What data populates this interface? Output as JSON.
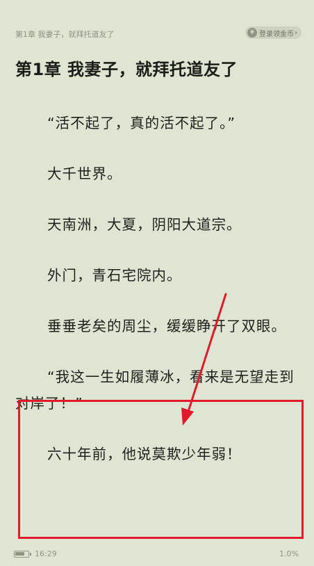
{
  "header": {
    "chapter_short": "第1章 我妻子，就拜托道友了",
    "coin_button": {
      "icon": "yen-coin-icon",
      "label": "登录领金币",
      "chevron": "›"
    }
  },
  "chapter": {
    "title": "第1章 我妻子，就拜托道友了",
    "paragraphs": [
      "“活不起了，真的活不起了。”",
      "大千世界。",
      "天南洲，大夏，阴阳大道宗。",
      "外门，青石宅院内。",
      "垂垂老矣的周尘，缓缓睁开了双眼。",
      "“我这一生如履薄冰，看来是无望走到对岸了！”",
      "六十年前，他说莫欺少年弱！"
    ]
  },
  "footer": {
    "battery_icon": "battery-icon",
    "battery_level": 0.75,
    "time": "16:29",
    "progress": "1.0%"
  },
  "annotation": {
    "color": "#e0192b",
    "type": "red-arrow-and-box"
  }
}
